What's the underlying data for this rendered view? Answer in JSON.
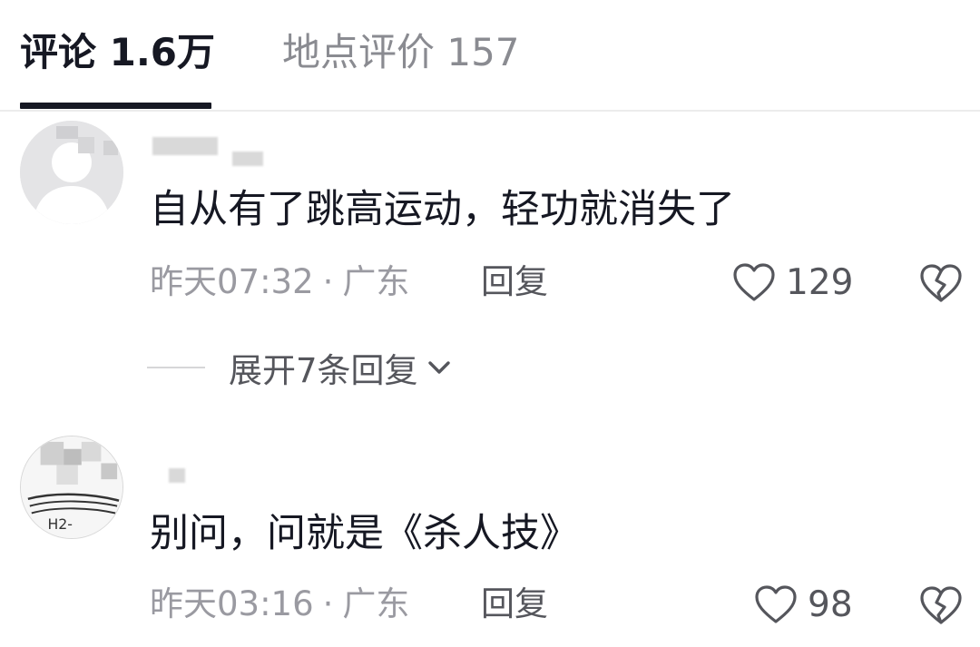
{
  "tabs": [
    {
      "label": "评论 1.6万",
      "active": true
    },
    {
      "label": "地点评价 157",
      "active": false
    }
  ],
  "comments": [
    {
      "text": "自从有了跳高运动，轻功就消失了",
      "time": "昨天07:32",
      "separator": "·",
      "location": "广东",
      "reply_label": "回复",
      "likes": "129",
      "expand_label": "展开7条回复"
    },
    {
      "text": "别问，问就是《杀人技》",
      "time": "昨天03:16",
      "separator": "·",
      "location": "广东",
      "reply_label": "回复",
      "likes": "98"
    }
  ],
  "icons": {
    "like": "heart-outline-icon",
    "dislike": "broken-heart-icon",
    "expand": "chevron-down-icon"
  },
  "colors": {
    "text_primary": "#161823",
    "text_secondary": "#9a9aa1",
    "icon": "#55565c"
  }
}
